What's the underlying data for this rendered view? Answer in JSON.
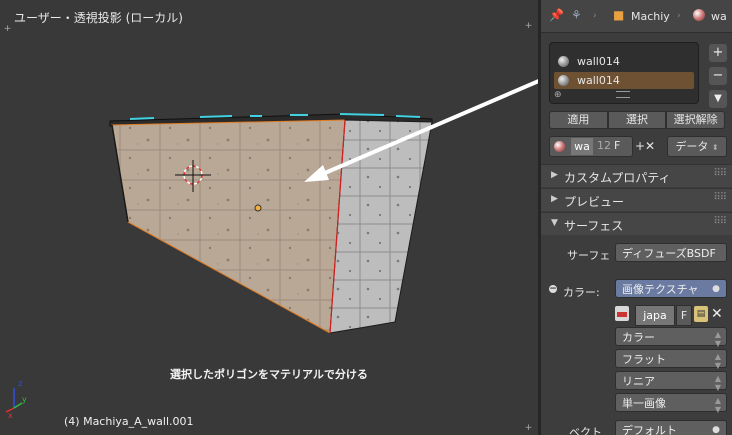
{
  "viewport": {
    "title": "ユーザー・透視投影 (ローカル)",
    "caption": "選択したポリゴンをマテリアルで分ける",
    "object_label": "(4) Machiya_A_wall.001"
  },
  "header": {
    "breadcrumb_object": "Machiy",
    "breadcrumb_material": "wa"
  },
  "material_slots": [
    {
      "name": "wall014",
      "selected": false
    },
    {
      "name": "wall014",
      "selected": true
    }
  ],
  "slot_side_buttons": [
    "+",
    "−",
    "▼"
  ],
  "assign_buttons": [
    "適用",
    "選択",
    "選択解除"
  ],
  "material_row": {
    "name": "wa",
    "users": "12",
    "fake": "F",
    "add_remove": "+✕",
    "link": "データ"
  },
  "panels": {
    "custom_props": "カスタムプロパティ",
    "preview": "プレビュー",
    "surface": "サーフェス"
  },
  "surface": {
    "label": "サーフェ",
    "value": "ディフューズBSDF",
    "color_label": "カラー:",
    "color_value": "画像テクスチャ",
    "image_name": "japa",
    "image_fake": "F",
    "dropdowns": [
      "カラー",
      "フラット",
      "リニア",
      "単一画像"
    ],
    "vector_label": "ベクト",
    "vector_value": "デフォルト"
  },
  "colors": {
    "selected_slot": "#6e5133",
    "accent_blue": "#6a7aa0",
    "edge_orange": "#e07a20",
    "seam_cyan": "#40d0e0"
  }
}
